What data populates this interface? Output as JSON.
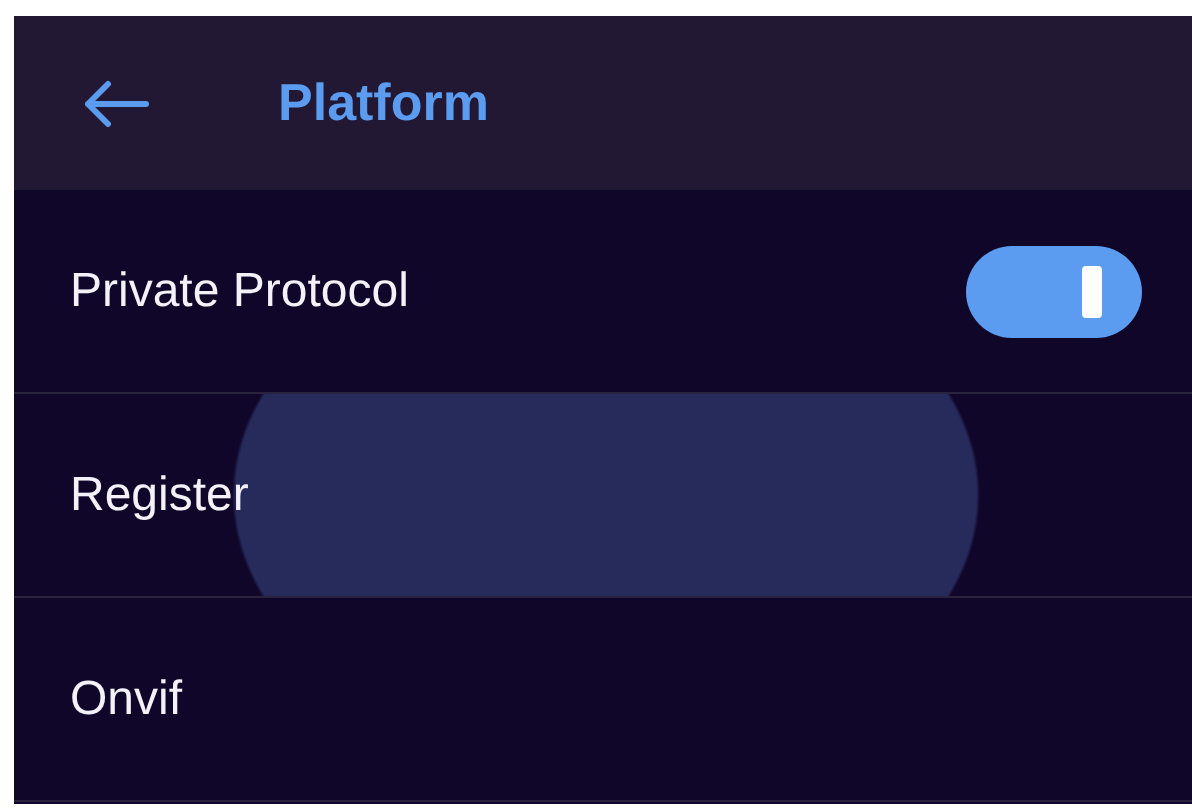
{
  "header": {
    "title": "Platform"
  },
  "items": [
    {
      "kind": "toggle",
      "label": "Private Protocol",
      "on": true,
      "pressed": false
    },
    {
      "kind": "link",
      "label": "Register",
      "pressed": true
    },
    {
      "kind": "link",
      "label": "Onvif",
      "pressed": false
    }
  ]
}
